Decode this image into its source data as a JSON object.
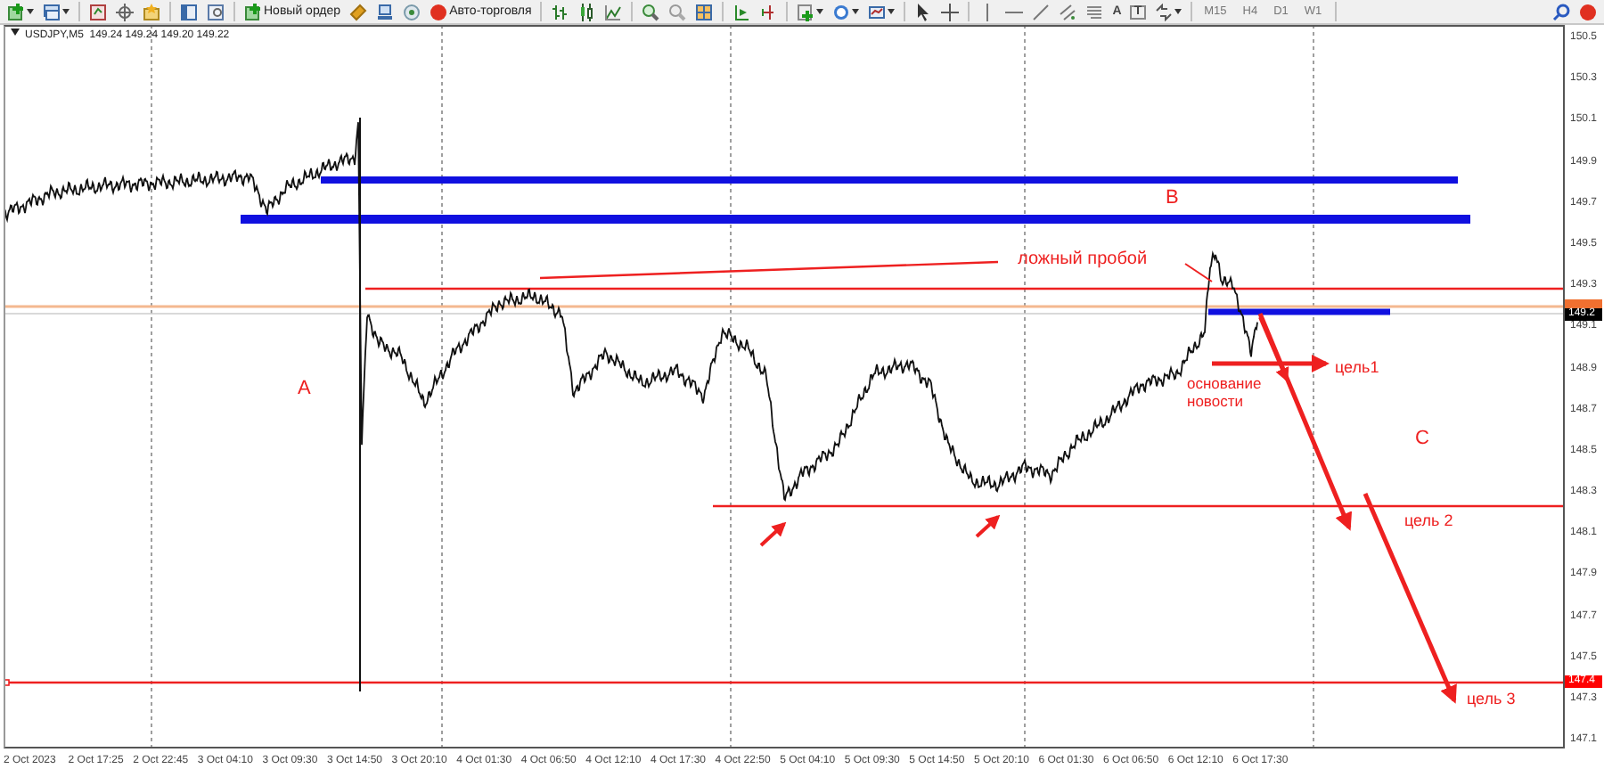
{
  "toolbar": {
    "order_button": "Новый ордер",
    "autotrade_button": "Авто-торговля",
    "text_tools": [
      "A",
      "T"
    ],
    "timeframes": [
      {
        "label": "M15"
      },
      {
        "label": "H4"
      },
      {
        "label": "D1"
      },
      {
        "label": "W1"
      }
    ]
  },
  "chart": {
    "legend": "USDJPY,M5  149.24 149.24 149.20 149.22",
    "price_labels": [
      "150.5",
      "150.3",
      "150.1",
      "149.9",
      "149.7",
      "149.5",
      "149.3",
      "149.1",
      "148.9",
      "148.7",
      "148.5",
      "148.3",
      "148.1",
      "147.9",
      "147.7",
      "147.5",
      "147.3",
      "147.1"
    ],
    "price_tags": [
      {
        "label": "149.2",
        "color": "#000000"
      },
      {
        "label": "147.4",
        "color": "#ff0000"
      }
    ],
    "time_labels": [
      "2 Oct 2023",
      "2 Oct 17:25",
      "2 Oct 22:45",
      "3 Oct 04:10",
      "3 Oct 09:30",
      "3 Oct 14:50",
      "3 Oct 20:10",
      "4 Oct 01:30",
      "4 Oct 06:50",
      "4 Oct 12:10",
      "4 Oct 17:30",
      "4 Oct 22:50",
      "5 Oct 04:10",
      "5 Oct 09:30",
      "5 Oct 14:50",
      "5 Oct 20:10",
      "6 Oct 01:30",
      "6 Oct 06:50",
      "6 Oct 12:10",
      "6 Oct 17:30"
    ],
    "annotations": [
      {
        "text": "A"
      },
      {
        "text": "B"
      },
      {
        "text": "ложный пробой"
      },
      {
        "text": "основание новости"
      },
      {
        "text": "цель1"
      },
      {
        "text": "C"
      },
      {
        "text": "цель 2"
      },
      {
        "text": "цель 3"
      }
    ]
  }
}
